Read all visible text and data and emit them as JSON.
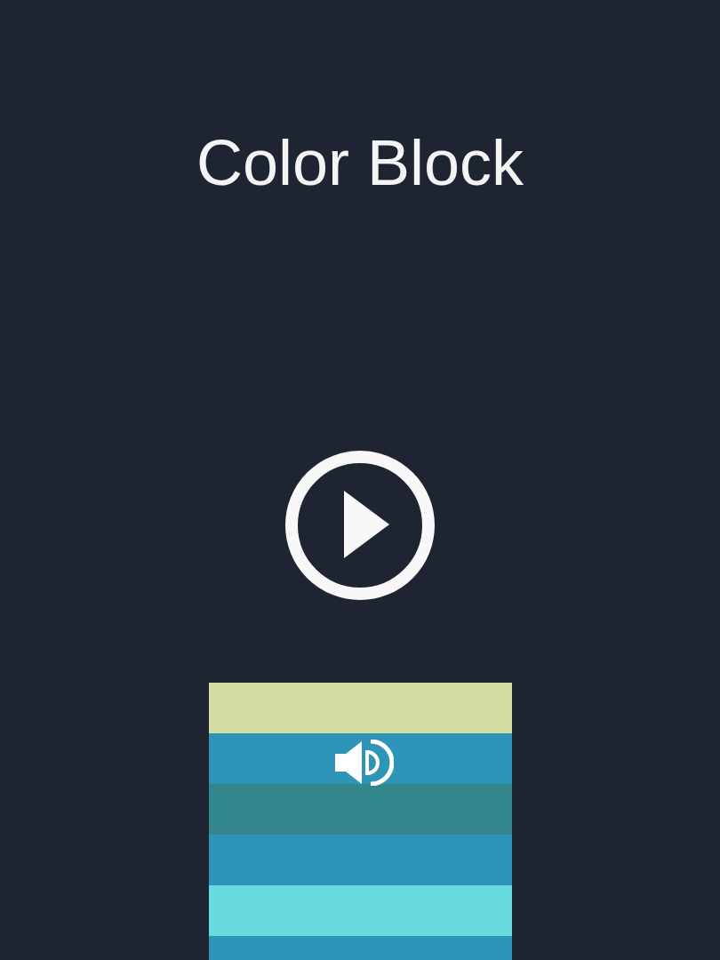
{
  "title": "Color Block",
  "stripes": [
    {
      "color": "#d4dea3"
    },
    {
      "color": "#2e94b8"
    },
    {
      "color": "#32868c"
    },
    {
      "color": "#2e94b8"
    },
    {
      "color": "#68dbe0"
    },
    {
      "color": "#2e94b8"
    }
  ]
}
